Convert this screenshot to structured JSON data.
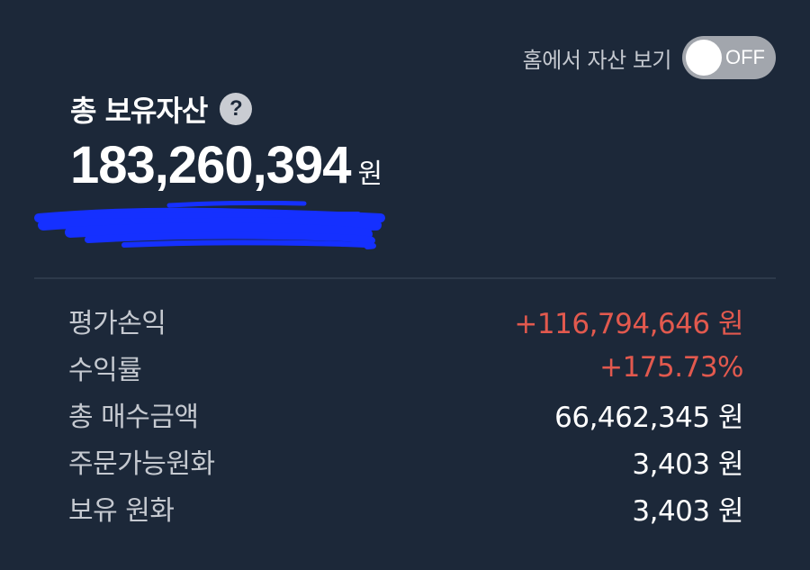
{
  "home_toggle": {
    "label": "홈에서 자산 보기",
    "state_text": "OFF"
  },
  "total_assets": {
    "title": "총 보유자산",
    "help_icon": "question-mark-icon",
    "amount": "183,260,394",
    "unit": "원"
  },
  "summary": {
    "rows": [
      {
        "label": "평가손익",
        "value": "+116,794,646 원",
        "status": "positive"
      },
      {
        "label": "수익률",
        "value": "+175.73%",
        "status": "positive"
      },
      {
        "label": "총 매수금액",
        "value": "66,462,345 원",
        "status": "neutral"
      },
      {
        "label": "주문가능원화",
        "value": "3,403 원",
        "status": "neutral"
      },
      {
        "label": "보유 원화",
        "value": "3,403 원",
        "status": "neutral"
      }
    ]
  },
  "colors": {
    "background": "#1c2839",
    "positive": "#e2594e",
    "redaction": "#1530ff"
  }
}
